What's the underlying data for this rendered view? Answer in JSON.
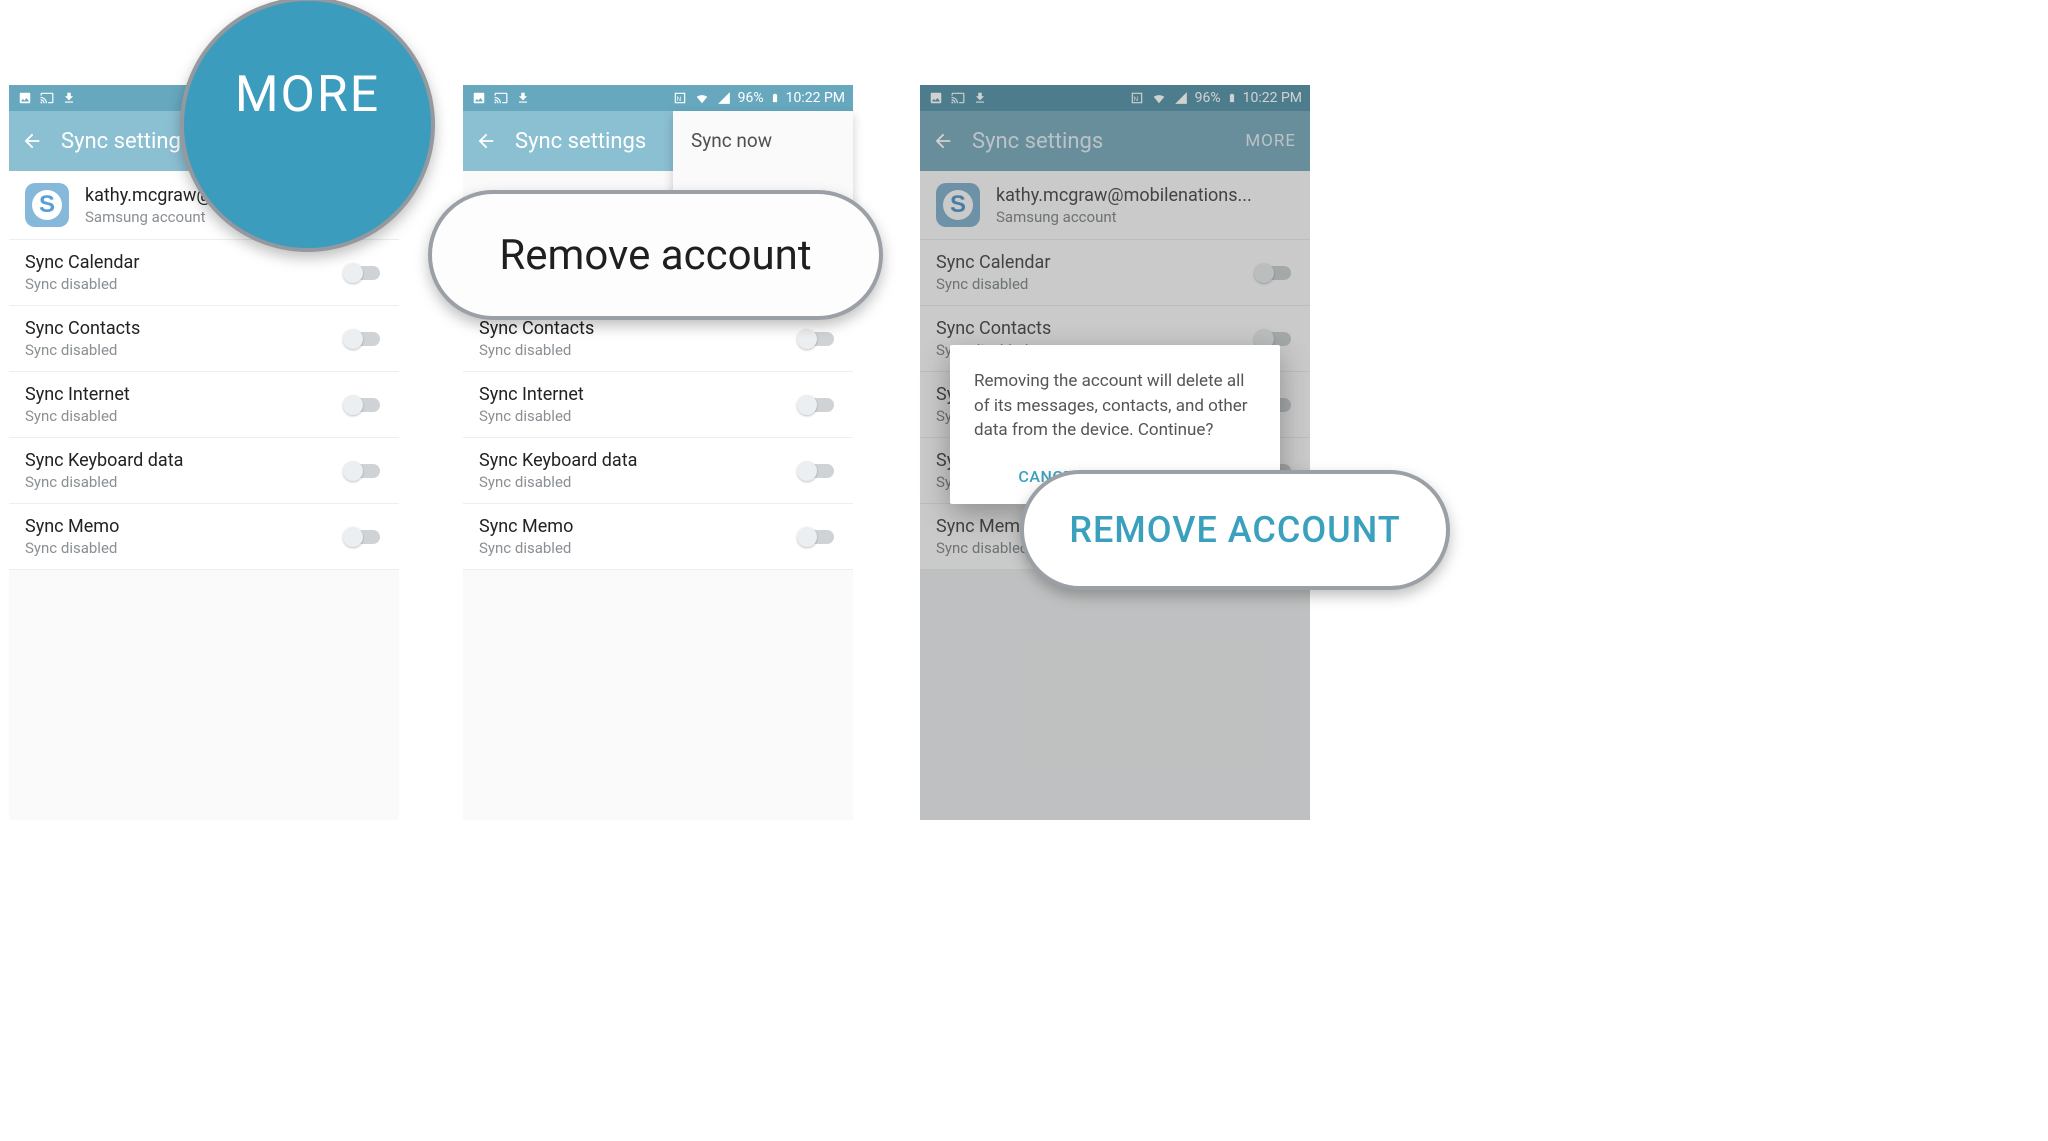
{
  "status": {
    "left_icons": [
      "image-icon",
      "cast-icon",
      "download-icon"
    ],
    "right_text": "96%",
    "time": "10:22 PM"
  },
  "appbar": {
    "title": "Sync settings",
    "more": "MORE"
  },
  "account": {
    "email_short": "kathy.mcgraw@",
    "email_full": "kathy.mcgraw@mobilenations...",
    "provider": "Samsung account"
  },
  "sync_items": [
    {
      "label": "Sync Calendar",
      "sub": "Sync disabled"
    },
    {
      "label": "Sync Contacts",
      "sub": "Sync disabled"
    },
    {
      "label": "Sync Internet",
      "sub": "Sync disabled"
    },
    {
      "label": "Sync Keyboard data",
      "sub": "Sync disabled"
    },
    {
      "label": "Sync Memo",
      "sub": "Sync disabled"
    }
  ],
  "popup": {
    "sync_now": "Sync now",
    "remove": "Remove account"
  },
  "dialog": {
    "body": "Removing the account will delete all of its messages, contacts, and other data from the device. Continue?",
    "cancel": "CANCEL",
    "confirm": "REMOVE ACCOUNT"
  },
  "callouts": {
    "c1": "MORE",
    "c2": "Remove account",
    "c3": "REMOVE ACCOUNT"
  }
}
